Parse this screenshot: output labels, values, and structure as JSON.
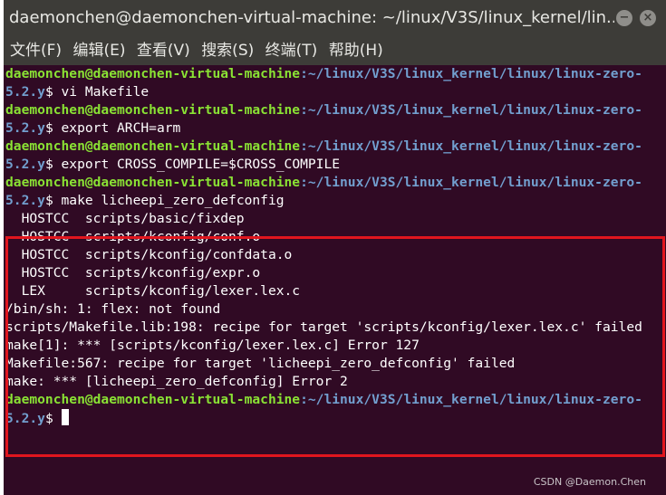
{
  "window": {
    "title": "daemonchen@daemonchen-virtual-machine: ~/linux/V3S/linux_kernel/lin...",
    "minimize_glyph": "−",
    "close_glyph": "×"
  },
  "menu": [
    {
      "label": "文件(F)"
    },
    {
      "label": "编辑(E)"
    },
    {
      "label": "查看(V)"
    },
    {
      "label": "搜索(S)"
    },
    {
      "label": "终端(T)"
    },
    {
      "label": "帮助(H)"
    }
  ],
  "prompt": {
    "user_host": "daemonchen@daemonchen-virtual-machine",
    "path_line1": ":~/linux/V3S/linux_kernel/linux/linux-zero-",
    "path_line2": "5.2.y",
    "symbol": "$"
  },
  "commands": [
    " vi Makefile",
    " export ARCH=arm",
    " export CROSS_COMPILE=$CROSS_COMPILE",
    " make licheepi_zero_defconfig",
    ""
  ],
  "output": [
    "  HOSTCC  scripts/basic/fixdep",
    "  HOSTCC  scripts/kconfig/conf.o",
    "  HOSTCC  scripts/kconfig/confdata.o",
    "  HOSTCC  scripts/kconfig/expr.o",
    "  LEX     scripts/kconfig/lexer.lex.c",
    "/bin/sh: 1: flex: not found",
    "scripts/Makefile.lib:198: recipe for target 'scripts/kconfig/lexer.lex.c' failed",
    "make[1]: *** [scripts/kconfig/lexer.lex.c] Error 127",
    "Makefile:567: recipe for target 'licheepi_zero_defconfig' failed",
    "make: *** [licheepi_zero_defconfig] Error 2"
  ],
  "watermark": "CSDN @Daemon.Chen",
  "colors": {
    "background": "#300a24",
    "user_host": "#8ae234",
    "path": "#729fcf",
    "highlight_border": "#e0161e"
  }
}
